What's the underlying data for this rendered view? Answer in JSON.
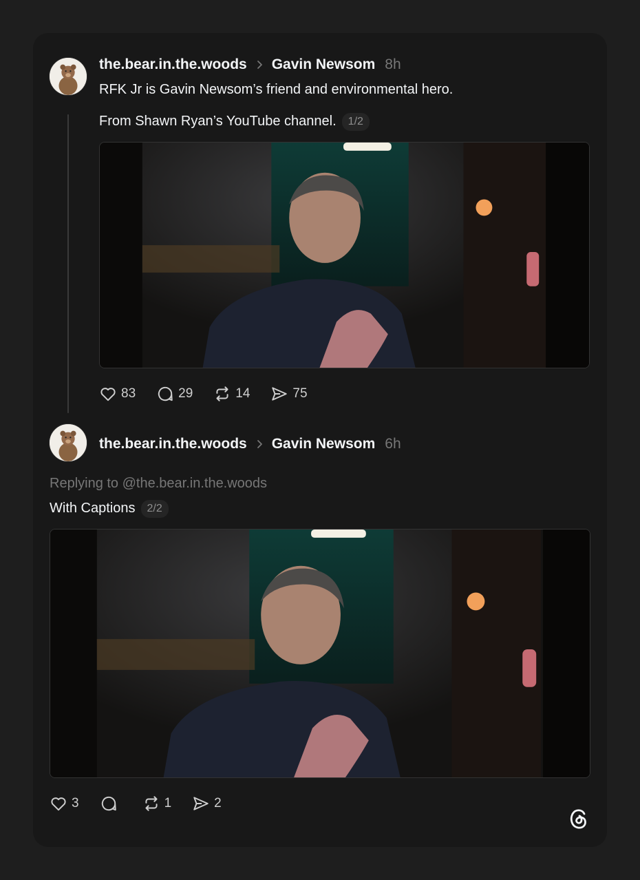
{
  "post1": {
    "username": "the.bear.in.the.woods",
    "target": "Gavin Newsom",
    "time": "8h",
    "text_line1": "RFK Jr is Gavin Newsom’s friend and environmental hero.",
    "text_line2": "From Shawn Ryan’s YouTube channel.",
    "pill": "1/2",
    "actions": {
      "likes": "83",
      "replies": "29",
      "reposts": "14",
      "shares": "75"
    }
  },
  "post2": {
    "username": "the.bear.in.the.woods",
    "target": "Gavin Newsom",
    "time": "6h",
    "replying_to": "Replying to @the.bear.in.the.woods",
    "text": "With Captions",
    "pill": "2/2",
    "actions": {
      "likes": "3",
      "replies": "",
      "reposts": "1",
      "shares": "2"
    }
  },
  "icons": {
    "like": "heart-icon",
    "reply": "speech-bubble-icon",
    "repost": "repost-arrows-icon",
    "share": "paper-plane-icon",
    "logo": "threads-logo-icon"
  },
  "colors": {
    "background": "#1e1e1e",
    "card": "#181818",
    "text": "#f3f5f7",
    "muted": "#777777"
  }
}
